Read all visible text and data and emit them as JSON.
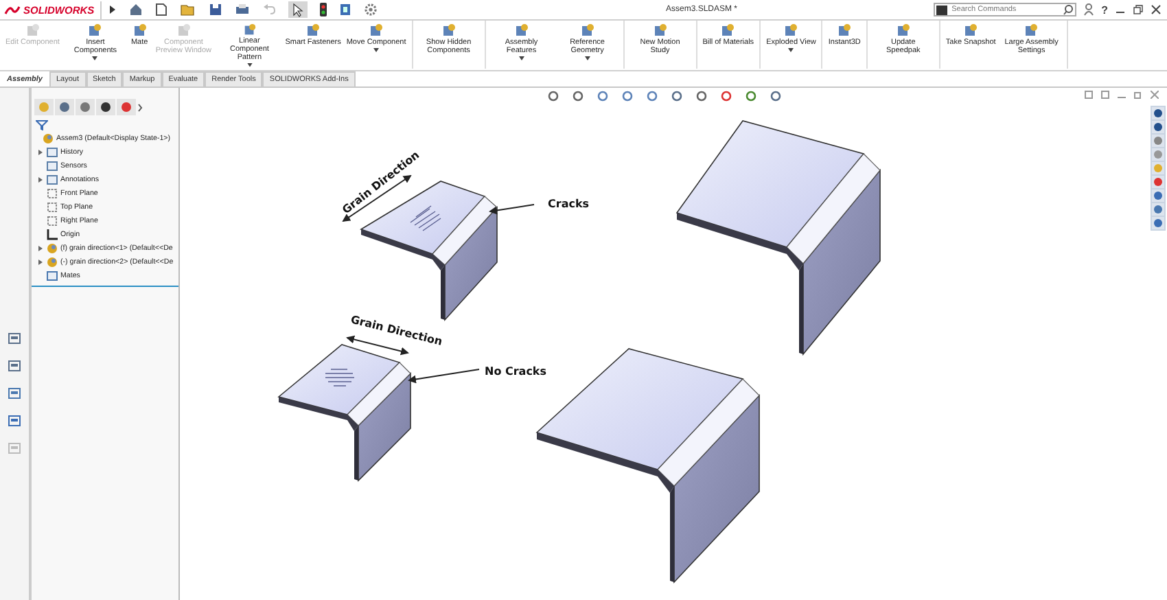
{
  "titlebar": {
    "brand": "SOLIDWORKS",
    "document_title": "Assem3.SLDASM *",
    "search": {
      "placeholder": "Search Commands"
    },
    "help_label": "?"
  },
  "ribbon": {
    "groups": [
      [
        {
          "label": "Edit Component",
          "disabled": true,
          "has_menu": false
        },
        {
          "label": "Insert Components",
          "disabled": false,
          "has_menu": true
        },
        {
          "label": "Mate",
          "disabled": false,
          "has_menu": false
        },
        {
          "label": "Component Preview Window",
          "disabled": true,
          "has_menu": false
        },
        {
          "label": "Linear Component Pattern",
          "disabled": false,
          "has_menu": true
        },
        {
          "label": "Smart Fasteners",
          "disabled": false,
          "has_menu": false
        },
        {
          "label": "Move Component",
          "disabled": false,
          "has_menu": true
        }
      ],
      [
        {
          "label": "Show Hidden Components",
          "disabled": false,
          "has_menu": false
        }
      ],
      [
        {
          "label": "Assembly Features",
          "disabled": false,
          "has_menu": true
        },
        {
          "label": "Reference Geometry",
          "disabled": false,
          "has_menu": true
        }
      ],
      [
        {
          "label": "New Motion Study",
          "disabled": false,
          "has_menu": false
        }
      ],
      [
        {
          "label": "Bill of Materials",
          "disabled": false,
          "has_menu": false
        }
      ],
      [
        {
          "label": "Exploded View",
          "disabled": false,
          "has_menu": true
        }
      ],
      [
        {
          "label": "Instant3D",
          "disabled": false,
          "has_menu": false
        }
      ],
      [
        {
          "label": "Update Speedpak",
          "disabled": false,
          "has_menu": false
        }
      ],
      [
        {
          "label": "Take Snapshot",
          "disabled": false,
          "has_menu": false
        },
        {
          "label": "Large Assembly Settings",
          "disabled": false,
          "has_menu": false
        }
      ]
    ]
  },
  "tabs": [
    {
      "label": "Assembly",
      "selected": true
    },
    {
      "label": "Layout",
      "selected": false
    },
    {
      "label": "Sketch",
      "selected": false
    },
    {
      "label": "Markup",
      "selected": false
    },
    {
      "label": "Evaluate",
      "selected": false
    },
    {
      "label": "Render Tools",
      "selected": false
    },
    {
      "label": "SOLIDWORKS Add-Ins",
      "selected": false
    }
  ],
  "feature_tree": {
    "items": [
      {
        "label": "Assem3  (Default<Display State-1>)",
        "kind": "assembly",
        "expandable": false
      },
      {
        "label": "History",
        "kind": "folder",
        "expandable": true
      },
      {
        "label": "Sensors",
        "kind": "folder",
        "expandable": false
      },
      {
        "label": "Annotations",
        "kind": "folder",
        "expandable": true
      },
      {
        "label": "Front Plane",
        "kind": "plane",
        "expandable": false
      },
      {
        "label": "Top Plane",
        "kind": "plane",
        "expandable": false
      },
      {
        "label": "Right Plane",
        "kind": "plane",
        "expandable": false
      },
      {
        "label": "Origin",
        "kind": "origin",
        "expandable": false
      },
      {
        "label": "(f) grain direction<1> (Default<<De",
        "kind": "part",
        "expandable": true
      },
      {
        "label": "(-) grain direction<2> (Default<<De",
        "kind": "part",
        "expandable": true
      },
      {
        "label": "Mates",
        "kind": "mates",
        "expandable": false
      }
    ]
  },
  "canvas": {
    "annotations": [
      {
        "text": "Grain Direction"
      },
      {
        "text": "Cracks"
      },
      {
        "text": "Grain Direction"
      },
      {
        "text": "No Cracks"
      }
    ]
  }
}
